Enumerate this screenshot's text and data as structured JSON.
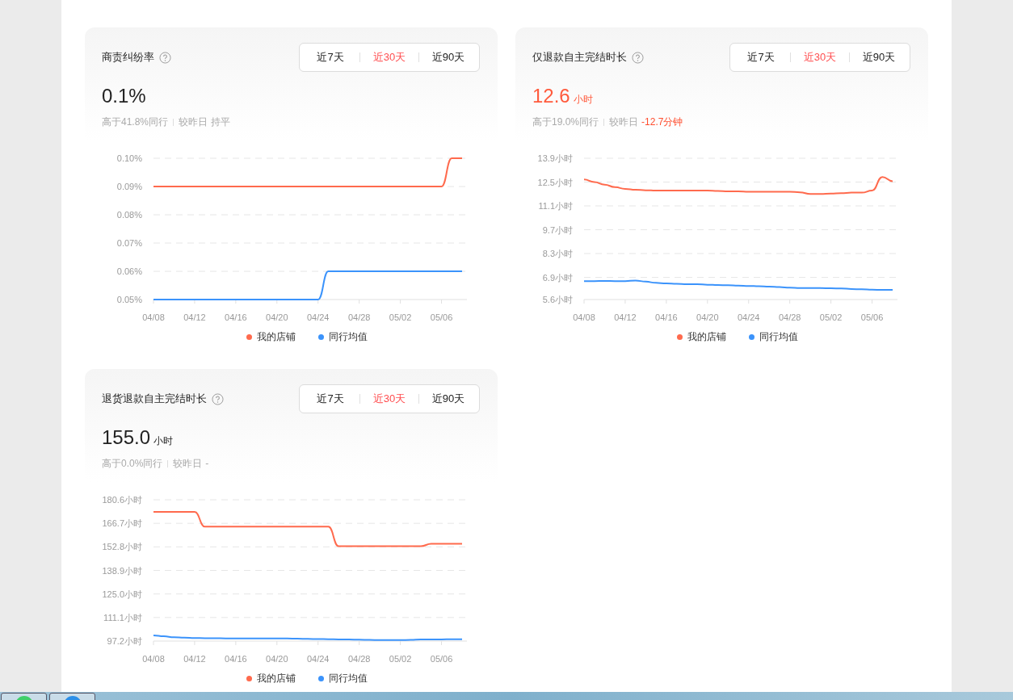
{
  "cards": [
    {
      "title": "商责纠纷率",
      "ranges": [
        {
          "label": "近7天",
          "selected": false
        },
        {
          "label": "近30天",
          "selected": true
        },
        {
          "label": "近90天",
          "selected": false
        }
      ],
      "value": "0.1%",
      "value_highlight": false,
      "compare": "高于41.8%同行",
      "day_label": "较昨日",
      "day_change": "持平",
      "change_highlight": false,
      "chart_data": {
        "type": "line",
        "grid": true,
        "legend": true,
        "categories": [
          "04/08",
          null,
          null,
          null,
          "04/12",
          null,
          null,
          null,
          "04/16",
          null,
          null,
          null,
          "04/20",
          null,
          null,
          null,
          "04/24",
          null,
          null,
          null,
          "04/28",
          null,
          null,
          null,
          "05/02",
          null,
          null,
          null,
          "05/06",
          null,
          null
        ],
        "ylim": [
          0.05,
          0.1
        ],
        "yticks": [
          {
            "value": 0.1,
            "label": "0.10%"
          },
          {
            "value": 0.09,
            "label": "0.09%"
          },
          {
            "value": 0.08,
            "label": "0.08%"
          },
          {
            "value": 0.07,
            "label": "0.07%"
          },
          {
            "value": 0.06,
            "label": "0.06%"
          },
          {
            "value": 0.05,
            "label": "0.05%"
          }
        ],
        "series": [
          {
            "name": "我的店铺",
            "color": "#ff6a4d",
            "values": [
              0.09,
              0.09,
              0.09,
              0.09,
              0.09,
              0.09,
              0.09,
              0.09,
              0.09,
              0.09,
              0.09,
              0.09,
              0.09,
              0.09,
              0.09,
              0.09,
              0.09,
              0.09,
              0.09,
              0.09,
              0.09,
              0.09,
              0.09,
              0.09,
              0.09,
              0.09,
              0.09,
              0.09,
              0.09,
              0.1,
              0.1
            ]
          },
          {
            "name": "同行均值",
            "color": "#3b93fb",
            "values": [
              0.05,
              0.05,
              0.05,
              0.05,
              0.05,
              0.05,
              0.05,
              0.05,
              0.05,
              0.05,
              0.05,
              0.05,
              0.05,
              0.05,
              0.05,
              0.05,
              0.05,
              0.06,
              0.06,
              0.06,
              0.06,
              0.06,
              0.06,
              0.06,
              0.06,
              0.06,
              0.06,
              0.06,
              0.06,
              0.06,
              0.06
            ]
          }
        ]
      }
    },
    {
      "title": "仅退款自主完结时长",
      "ranges": [
        {
          "label": "近7天",
          "selected": false
        },
        {
          "label": "近30天",
          "selected": true
        },
        {
          "label": "近90天",
          "selected": false
        }
      ],
      "value": "12.6",
      "unit": "小时",
      "value_highlight": true,
      "compare": "高于19.0%同行",
      "day_label": "较昨日",
      "day_change": "-12.7分钟",
      "change_highlight": true,
      "chart_data": {
        "type": "line",
        "grid": true,
        "legend": true,
        "categories": [
          "04/08",
          null,
          null,
          null,
          "04/12",
          null,
          null,
          null,
          "04/16",
          null,
          null,
          null,
          "04/20",
          null,
          null,
          null,
          "04/24",
          null,
          null,
          null,
          "04/28",
          null,
          null,
          null,
          "05/02",
          null,
          null,
          null,
          "05/06",
          null,
          null
        ],
        "ylim": [
          5.6,
          13.9
        ],
        "yticks": [
          {
            "value": 13.9,
            "label": "13.9小时"
          },
          {
            "value": 12.5,
            "label": "12.5小时"
          },
          {
            "value": 11.1,
            "label": "11.1小时"
          },
          {
            "value": 9.7,
            "label": "9.7小时"
          },
          {
            "value": 8.3,
            "label": "8.3小时"
          },
          {
            "value": 6.9,
            "label": "6.9小时"
          },
          {
            "value": 5.6,
            "label": "5.6小时"
          }
        ],
        "series": [
          {
            "name": "我的店铺",
            "color": "#ff6a4d",
            "values": [
              12.65,
              12.5,
              12.35,
              12.2,
              12.1,
              12.05,
              12.02,
              12.0,
              12.0,
              12.0,
              12.0,
              12.0,
              12.0,
              11.98,
              11.95,
              11.95,
              11.93,
              11.93,
              11.93,
              11.93,
              11.93,
              11.9,
              11.8,
              11.8,
              11.82,
              11.85,
              11.88,
              11.88,
              12.0,
              12.8,
              12.55
            ]
          },
          {
            "name": "同行均值",
            "color": "#3b93fb",
            "values": [
              6.68,
              6.68,
              6.69,
              6.68,
              6.68,
              6.72,
              6.65,
              6.58,
              6.55,
              6.52,
              6.5,
              6.5,
              6.47,
              6.45,
              6.44,
              6.42,
              6.4,
              6.38,
              6.36,
              6.33,
              6.3,
              6.28,
              6.27,
              6.27,
              6.26,
              6.25,
              6.22,
              6.2,
              6.18,
              6.17,
              6.17
            ]
          }
        ]
      }
    },
    {
      "title": "退货退款自主完结时长",
      "ranges": [
        {
          "label": "近7天",
          "selected": false
        },
        {
          "label": "近30天",
          "selected": true
        },
        {
          "label": "近90天",
          "selected": false
        }
      ],
      "value": "155.0",
      "unit": "小时",
      "value_highlight": false,
      "compare": "高于0.0%同行",
      "day_label": "较昨日",
      "day_change": "-",
      "change_highlight": false,
      "chart_data": {
        "type": "line",
        "grid": true,
        "legend": true,
        "categories": [
          "04/08",
          null,
          null,
          null,
          "04/12",
          null,
          null,
          null,
          "04/16",
          null,
          null,
          null,
          "04/20",
          null,
          null,
          null,
          "04/24",
          null,
          null,
          null,
          "04/28",
          null,
          null,
          null,
          "05/02",
          null,
          null,
          null,
          "05/06",
          null,
          null
        ],
        "ylim": [
          97.2,
          180.6
        ],
        "yticks": [
          {
            "value": 180.6,
            "label": "180.6小时"
          },
          {
            "value": 166.7,
            "label": "166.7小时"
          },
          {
            "value": 152.8,
            "label": "152.8小时"
          },
          {
            "value": 138.9,
            "label": "138.9小时"
          },
          {
            "value": 125.0,
            "label": "125.0小时"
          },
          {
            "value": 111.1,
            "label": "111.1小时"
          },
          {
            "value": 97.2,
            "label": "97.2小时"
          }
        ],
        "series": [
          {
            "name": "我的店铺",
            "color": "#ff6a4d",
            "values": [
              173.4,
              173.4,
              173.4,
              173.4,
              173.4,
              164.7,
              164.7,
              164.7,
              164.7,
              164.7,
              164.7,
              164.7,
              164.7,
              164.7,
              164.7,
              164.7,
              164.7,
              164.7,
              153.2,
              153.2,
              153.2,
              153.2,
              153.2,
              153.2,
              153.2,
              153.2,
              153.2,
              154.6,
              154.6,
              154.6,
              154.6
            ]
          },
          {
            "name": "同行均值",
            "color": "#3b93fb",
            "values": [
              100.5,
              100,
              99.5,
              99.2,
              99,
              98.9,
              98.9,
              98.8,
              98.8,
              98.8,
              98.8,
              98.8,
              98.8,
              98.7,
              98.6,
              98.5,
              98.4,
              98.3,
              98.2,
              98.1,
              98.0,
              97.9,
              97.8,
              97.8,
              97.8,
              97.9,
              98.1,
              98.2,
              98.2,
              98.3,
              98.3
            ]
          }
        ]
      }
    }
  ],
  "taskbar": {
    "buttons": [
      {
        "color": "#3fcf6a"
      },
      {
        "color": "#2b8fe8"
      }
    ]
  }
}
